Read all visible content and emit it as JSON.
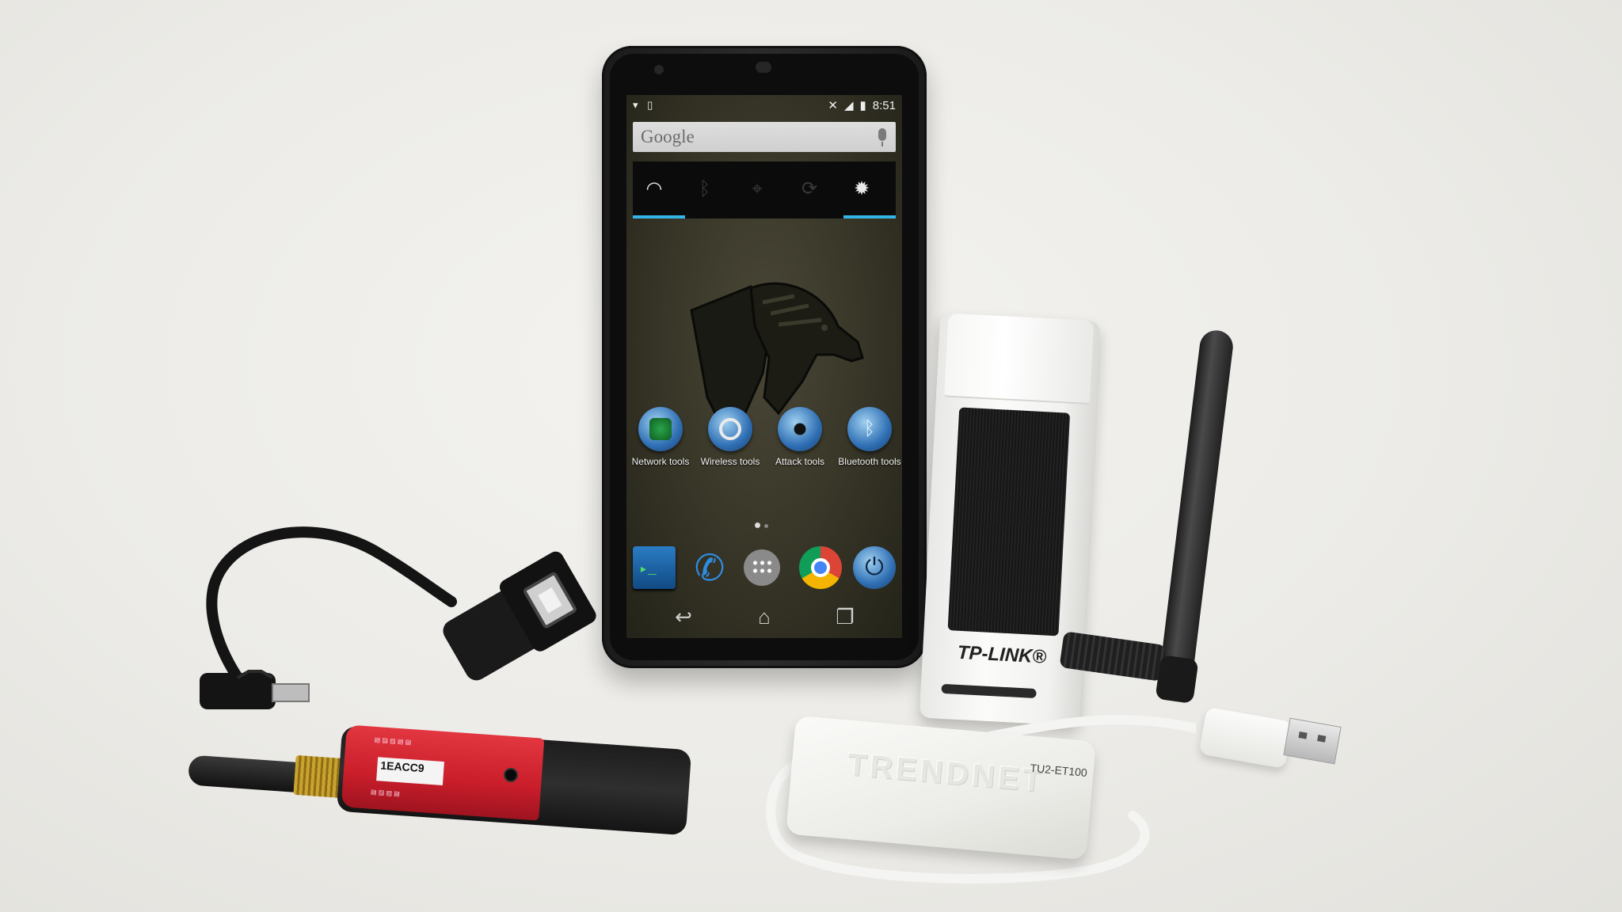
{
  "phone": {
    "status_time": "8:51",
    "search_label": "Google",
    "apps": [
      {
        "label": "Network tools",
        "icon": "fingerprint-icon"
      },
      {
        "label": "Wireless tools",
        "icon": "magnifier-icon"
      },
      {
        "label": "Attack tools",
        "icon": "spider-icon"
      },
      {
        "label": "Bluetooth tools",
        "icon": "bluetooth-icon"
      }
    ],
    "dock": [
      "terminal-icon",
      "phone-icon",
      "app-drawer-icon",
      "chrome-icon",
      "power-icon"
    ],
    "accent_color": "#33b5e5"
  },
  "tplink": {
    "brand": "TP-LINK®"
  },
  "dongle": {
    "id": "1EACC9"
  },
  "adapter": {
    "brand": "TRENDNET",
    "model": "TU2-ET100"
  }
}
